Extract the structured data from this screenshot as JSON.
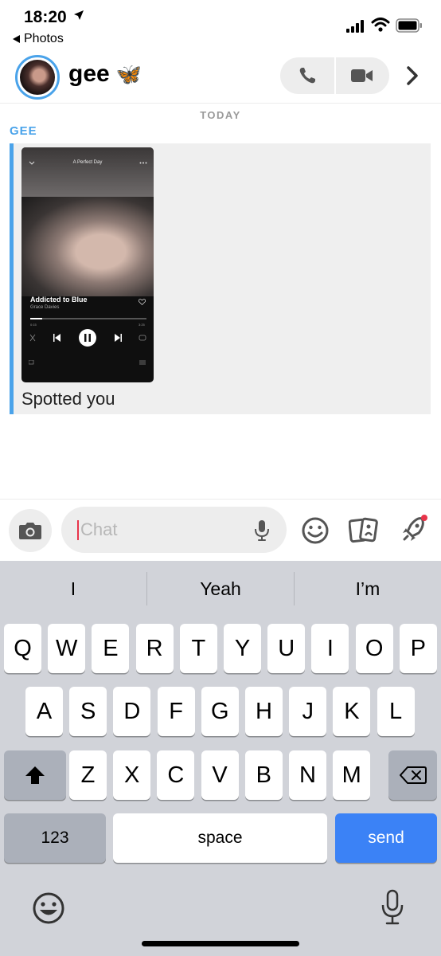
{
  "status": {
    "time": "18:20",
    "back_app": "Photos"
  },
  "header": {
    "name": "gee",
    "emoji": "🦋"
  },
  "conversation": {
    "date_label": "TODAY",
    "sender": "GEE",
    "snap": {
      "album_title": "A Perfect Day",
      "song_title": "Addicted to Blue",
      "artist": "Grace Davies",
      "elapsed": "0:15",
      "duration": "3:25",
      "progress": 0.1
    },
    "message_text": "Spotted you"
  },
  "input": {
    "placeholder": "Chat",
    "value": ""
  },
  "keyboard": {
    "suggestions": [
      "I",
      "Yeah",
      "I’m"
    ],
    "row1": [
      "Q",
      "W",
      "E",
      "R",
      "T",
      "Y",
      "U",
      "I",
      "O",
      "P"
    ],
    "row2": [
      "A",
      "S",
      "D",
      "F",
      "G",
      "H",
      "J",
      "K",
      "L"
    ],
    "row3": [
      "Z",
      "X",
      "C",
      "V",
      "B",
      "N",
      "M"
    ],
    "numbers_label": "123",
    "space_label": "space",
    "send_label": "send"
  },
  "colors": {
    "accent_blue": "#4aa3ea",
    "send_blue": "#3b82f6",
    "caret_red": "#e8344a",
    "notify_red": "#e8344a"
  },
  "icons": [
    "location-arrow-icon",
    "signal-icon",
    "wifi-icon",
    "battery-icon",
    "phone-icon",
    "video-icon",
    "chevron-right-icon",
    "camera-icon",
    "mic-icon",
    "smiley-icon",
    "cards-icon",
    "rocket-icon",
    "shift-icon",
    "backspace-icon",
    "emoji-keyboard-icon",
    "dictation-icon"
  ]
}
